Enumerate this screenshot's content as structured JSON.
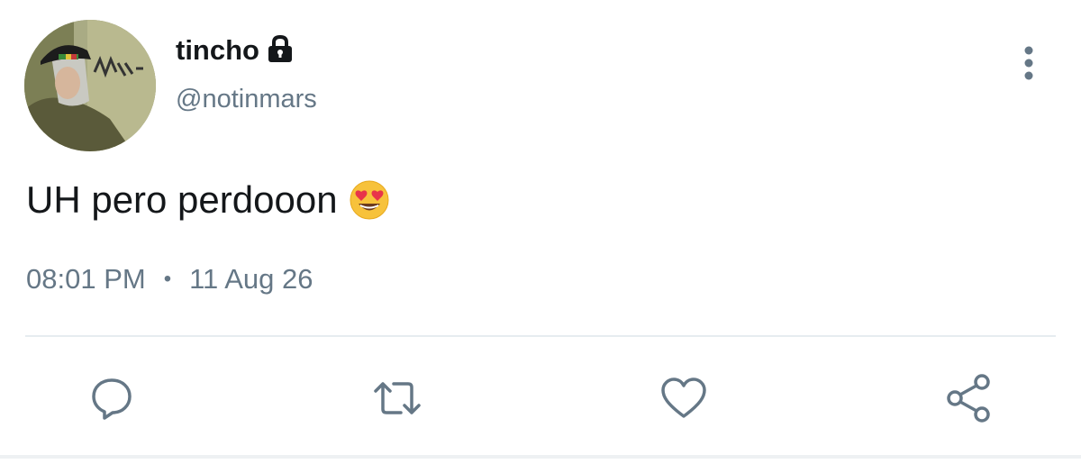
{
  "author": {
    "display_name": "tincho",
    "handle": "@notinmars",
    "protected": true
  },
  "tweet": {
    "text": "UH pero perdooon",
    "emoji": "smiling-face-with-heart-eyes",
    "time": "08:01 PM",
    "separator": "•",
    "date": "11 Aug 26"
  },
  "actions": [
    "reply-icon",
    "retweet-icon",
    "like-icon",
    "share-icon"
  ],
  "colors": {
    "primary_text": "#14171a",
    "secondary_text": "#657786",
    "icon": "#657786",
    "divider": "#e6ecf0"
  }
}
